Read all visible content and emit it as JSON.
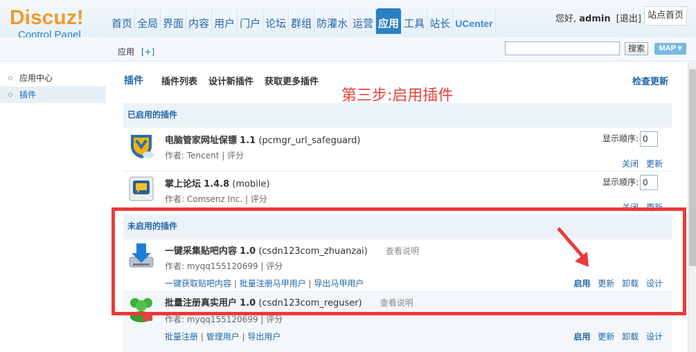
{
  "header": {
    "logo_text": "Discuz!",
    "logo_sub": "Control Panel",
    "nav": [
      "首页",
      "全局",
      "界面",
      "内容",
      "用户",
      "门户",
      "论坛",
      "群组",
      "防灌水",
      "运营",
      "应用",
      "工具",
      "站长",
      "UCenter"
    ],
    "nav_active": "应用",
    "greeting": "您好,",
    "username": "admin",
    "logout": "[退出]",
    "site_home": "站点首页"
  },
  "subbar": {
    "crumb": "应用",
    "crumb_add": "[+]",
    "search_button": "搜索",
    "map_button": "MAP ▾"
  },
  "sidebar": {
    "items": [
      {
        "label": "应用中心"
      },
      {
        "label": "插件"
      }
    ]
  },
  "main": {
    "tabs": [
      "插件",
      "插件列表",
      "设计新插件",
      "获取更多插件"
    ],
    "check_update": "检查更新",
    "annotation": "第三步:启用插件",
    "enabled_header": "已启用的插件",
    "disabled_header": "未启用的插件",
    "order_label": "显示顺序:",
    "readme": "查看说明",
    "enabled_plugins": [
      {
        "name": "电脑管家网址保镖",
        "version": "1.1",
        "id": "(pcmgr_url_safeguard)",
        "author": "作者: Tencent | ",
        "rate": "评分",
        "order": "0",
        "actions": [
          "关闭",
          "更新"
        ]
      },
      {
        "name": "掌上论坛",
        "version": "1.4.8",
        "id": "(mobile)",
        "author": "作者: Comsenz Inc. | ",
        "rate": "评分",
        "order": "0",
        "actions": [
          "关闭",
          "更新"
        ]
      }
    ],
    "disabled_plugins": [
      {
        "name": "一键采集贴吧内容",
        "version": "1.0",
        "id": "(csdn123com_zhuanzai)",
        "author": "作者: myqq155120699 | ",
        "rate": "评分",
        "links": [
          "一键获取贴吧内容",
          "批量注册马甲用户",
          "导出马甲用户"
        ],
        "actions": [
          "启用",
          "更新",
          "卸载",
          "设计"
        ]
      },
      {
        "name": "批量注册真实用户",
        "version": "1.0",
        "id": "(csdn123com_reguser)",
        "author": "作者: myqq155120699 | ",
        "rate": "评分",
        "links": [
          "批量注册",
          "管理用户",
          "导出用户"
        ],
        "actions": [
          "启用",
          "更新",
          "卸载",
          "设计"
        ]
      }
    ]
  },
  "colors": {
    "accent": "#2366a8",
    "nav_active_bg": "#2b80c3",
    "annotation_red": "#ec3a3a",
    "logo_orange": "#f39a2a"
  }
}
